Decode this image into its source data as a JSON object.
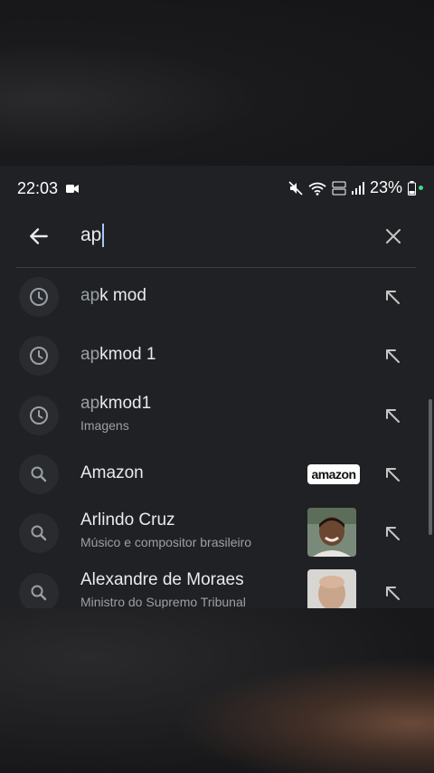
{
  "status_bar": {
    "time": "22:03",
    "battery": "23%",
    "icons": [
      "video-camera-icon",
      "mute-icon",
      "wifi-icon",
      "volte-icon",
      "signal-icon",
      "battery-icon"
    ]
  },
  "search": {
    "query_typed": "ap"
  },
  "suggestions": [
    {
      "kind": "history",
      "icon": "history-icon",
      "bold": "ap",
      "rest": "k mod",
      "subtitle": ""
    },
    {
      "kind": "history",
      "icon": "history-icon",
      "bold": "ap",
      "rest": "kmod 1",
      "subtitle": ""
    },
    {
      "kind": "history",
      "icon": "history-icon",
      "bold": "ap",
      "rest": "kmod1",
      "subtitle": "Imagens"
    },
    {
      "kind": "search",
      "icon": "search-icon",
      "title": "Amazon",
      "subtitle": "",
      "thumb": "amazon-logo",
      "thumb_text": "amazon"
    },
    {
      "kind": "search",
      "icon": "search-icon",
      "title": "Arlindo Cruz",
      "subtitle": "Músico e compositor brasileiro",
      "thumb": "person-photo"
    },
    {
      "kind": "search",
      "icon": "search-icon",
      "title": "Alexandre de Moraes",
      "subtitle": "Ministro do Supremo Tribunal",
      "thumb": "person-photo"
    }
  ],
  "colors": {
    "background": "#202124",
    "text": "#e8eaed",
    "muted": "#9aa0a6",
    "accent": "#a8c7fa"
  }
}
